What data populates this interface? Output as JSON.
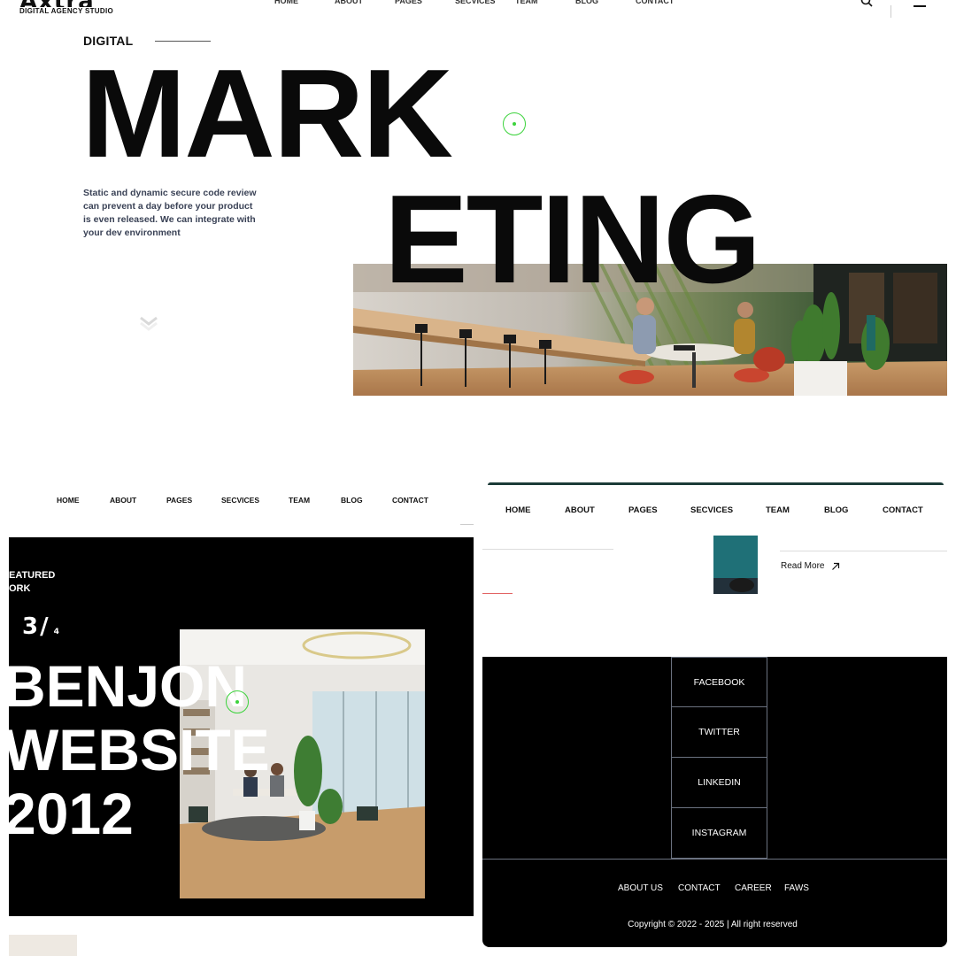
{
  "hero": {
    "logo_word": "Axtra",
    "logo_sub": "DIGITAL AGENCY STUDIO",
    "nav": [
      "HOME",
      "ABOUT",
      "PAGES",
      "SECVICES",
      "TEAM",
      "BLOG",
      "CONTACT"
    ],
    "eyebrow": "DIGITAL",
    "headline_1": "MARK",
    "headline_2": "ETING",
    "description": "Static and dynamic secure code review can prevent a day before your product is even released. We can integrate with your dev environment",
    "icons": {
      "search": "search-icon",
      "menu": "menu-icon",
      "scroll": "chevron-double-down-icon"
    }
  },
  "left_panel": {
    "nav": [
      "HOME",
      "ABOUT",
      "PAGES",
      "SECVICES",
      "TEAM",
      "BLOG",
      "CONTACT"
    ],
    "featured_line1": "EATURED",
    "featured_line2": "ORK",
    "counter_current": "3",
    "counter_sep": "/",
    "counter_total": "4",
    "title_line1": "BENJON",
    "title_line2": "WEBSITE",
    "title_line3": "2012"
  },
  "right_panel": {
    "nav": [
      "HOME",
      "ABOUT",
      "PAGES",
      "SECVICES",
      "TEAM",
      "BLOG",
      "CONTACT"
    ],
    "read_more": "Read More",
    "read_more_icon": "arrow-up-right-icon",
    "social": [
      "FACEBOOK",
      "TWITTER",
      "LINKEDIN",
      "INSTAGRAM"
    ],
    "footer_links": [
      "ABOUT US",
      "CONTACT",
      "CAREER",
      "FAWS"
    ],
    "copyright": "Copyright © 2022 - 2025 | All right reserved"
  },
  "colors": {
    "accent_cursor": "#3cd33c",
    "footer_bg": "#000000",
    "topbar_teal": "#1c3b38",
    "description_text": "#3a4256"
  }
}
